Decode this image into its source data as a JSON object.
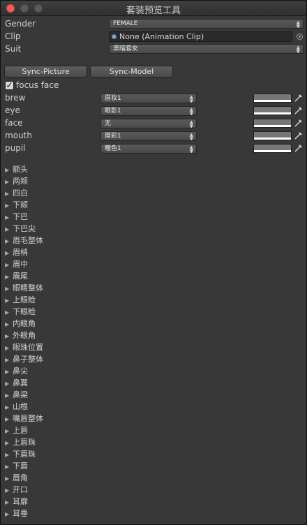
{
  "window": {
    "title": "套装预览工具"
  },
  "fields": {
    "gender": {
      "label": "Gender",
      "value": "FEMALE"
    },
    "clip": {
      "label": "Clip",
      "value": "None (Animation Clip)"
    },
    "suit": {
      "label": "Suit",
      "value": "黑暗套女"
    }
  },
  "buttons": {
    "sync_picture": "Sync-Picture",
    "sync_model": "Sync-Model"
  },
  "focus_face": {
    "label": "focus face",
    "checked": true
  },
  "face_rows": [
    {
      "label": "brew",
      "value": "眉妆1",
      "color": "#777777"
    },
    {
      "label": "eye",
      "value": "眼影1",
      "color": "#777777"
    },
    {
      "label": "face",
      "value": "无",
      "color": "#777777"
    },
    {
      "label": "mouth",
      "value": "唇彩1",
      "color": "#777777"
    },
    {
      "label": "pupil",
      "value": "瞳色1",
      "color": "#777777"
    }
  ],
  "tree_items": [
    "额头",
    "两颊",
    "四白",
    "下颏",
    "下巴",
    "下巴尖",
    "眉毛整体",
    "眉梢",
    "眉中",
    "眉尾",
    "眼睛整体",
    "上眼睑",
    "下眼睑",
    "内眼角",
    "外眼角",
    "眼珠位置",
    "鼻子整体",
    "鼻尖",
    "鼻翼",
    "鼻梁",
    "山根",
    "嘴唇整体",
    "上唇",
    "上唇珠",
    "下唇珠",
    "下唇",
    "唇角",
    "开口",
    "耳廓",
    "耳垂"
  ],
  "icons": {
    "clip_object": "object-dot-icon",
    "object_picker": "object-picker-icon",
    "eyedropper": "eyedropper-icon",
    "foldout": "foldout-triangle-icon"
  }
}
